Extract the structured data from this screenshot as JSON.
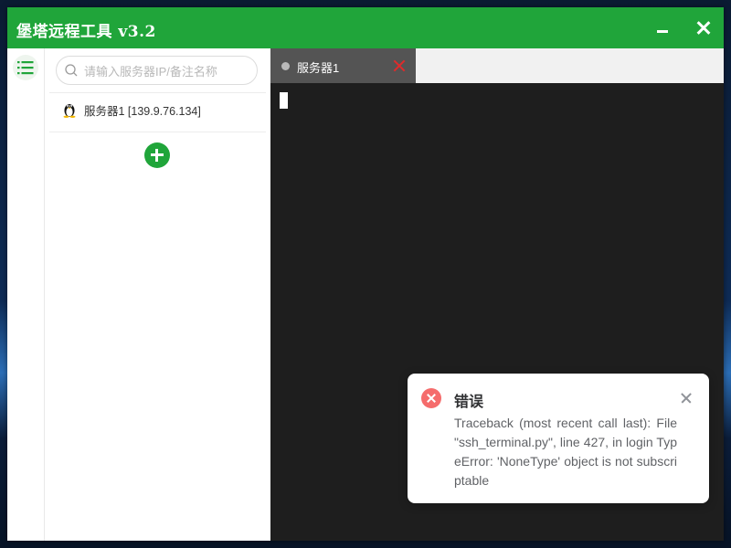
{
  "window": {
    "title": "堡塔远程工具 v3.2",
    "accent_color": "#20a53a"
  },
  "rail": {
    "menu_icon": "list-icon"
  },
  "sidebar": {
    "search_placeholder": "请输入服务器IP/备注名称",
    "search_value": "",
    "servers": [
      {
        "label": "服务器1 [139.9.76.134]",
        "icon": "linux-tux-icon"
      }
    ],
    "add_icon": "plus-circle-icon"
  },
  "tabs": [
    {
      "label": "服务器1",
      "active": true,
      "close_color": "#e02b2b"
    }
  ],
  "terminal": {
    "background": "#1e1e1e"
  },
  "toast": {
    "type": "error",
    "title": "错误",
    "message": "Traceback (most recent call last): File \"ssh_terminal.py\", line 427, in login TypeError: 'NoneType' object is not subscriptable",
    "icon_color": "#f56c6c"
  }
}
